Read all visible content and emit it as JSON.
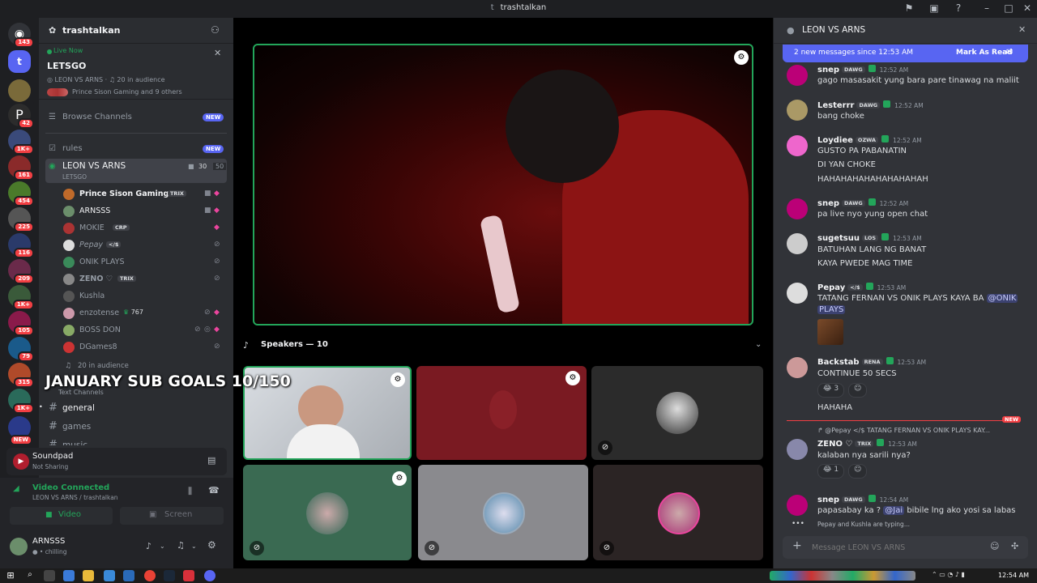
{
  "window": {
    "title": "trashtalkan"
  },
  "servers": [
    {
      "badge": "143"
    },
    {
      "badge": ""
    },
    {
      "badge": "42"
    },
    {
      "badge": "1K+"
    },
    {
      "badge": "161"
    },
    {
      "badge": "454"
    },
    {
      "badge": "225"
    },
    {
      "badge": "116"
    },
    {
      "badge": "209"
    },
    {
      "badge": "1K+"
    },
    {
      "badge": "105"
    },
    {
      "badge": "79"
    },
    {
      "badge": "315"
    },
    {
      "badge": "1K+"
    },
    {
      "badge": "NEW"
    }
  ],
  "sidebar": {
    "server_name": "trashtalkan",
    "live": {
      "status": "Live Now",
      "title": "LETSGO",
      "channel": "LEON VS ARNS",
      "audience": "20 in audience",
      "watchers": "Prince Sison Gaming and 9 others"
    },
    "browse": "Browse Channels",
    "new_label": "NEW",
    "rules": "rules",
    "voice_channel": {
      "name": "LEON VS ARNS",
      "status": "LETSGO",
      "count_a": "30",
      "count_b": "50"
    },
    "members": [
      {
        "name": "Prince Sison Gaming",
        "tag": "TRIX",
        "color": "#c06a2a"
      },
      {
        "name": "ARNSSS",
        "tag": "",
        "color": "#6b8e6b"
      },
      {
        "name": "MOKIE",
        "tag": "CRP",
        "color": "#a33"
      },
      {
        "name": "Pepay",
        "tag": "</$",
        "color": "#ddd"
      },
      {
        "name": "ONIK PLAYS",
        "tag": "",
        "color": "#3a8a5a"
      },
      {
        "name": "ZENO ♡",
        "tag": "TRIX",
        "color": "#888"
      },
      {
        "name": "Kushla",
        "tag": "",
        "color": "#555"
      },
      {
        "name": "enzotense",
        "tag": "767",
        "color": "#c9a"
      },
      {
        "name": "BOSS DON",
        "tag": "",
        "color": "#8a6"
      },
      {
        "name": "DGames8",
        "tag": "",
        "color": "#c33"
      }
    ],
    "audience": "20 in audience",
    "overlay": "JANUARY SUB GOALS 10/150",
    "text_channels_header": "Text Channels",
    "text_channels": [
      "general",
      "games",
      "music"
    ]
  },
  "panel": {
    "app": "Soundpad",
    "app_status": "Not Sharing",
    "connection": "Video Connected",
    "connection_sub": "LEON VS ARNS / trashtalkan",
    "video_btn": "Video",
    "screen_btn": "Screen",
    "user": "ARNSSS",
    "user_status": "chilling"
  },
  "stage": {
    "speakers_label": "Speakers — 10"
  },
  "chat": {
    "channel": "LEON VS ARNS",
    "new_banner": "2 new messages since 12:53 AM",
    "mark_read": "Mark As Read",
    "messages": [
      {
        "user": "snep",
        "tag": "DAWG",
        "time": "12:52 AM",
        "lines": [
          "gago masasakit yung bara pare tinawag na maliit"
        ],
        "color": "#b07"
      },
      {
        "user": "Lesterrr",
        "tag": "DAWG",
        "time": "12:52 AM",
        "lines": [
          "bang choke"
        ],
        "color": "#a96"
      },
      {
        "user": "Loydiee",
        "tag": "OZWA",
        "time": "12:52 AM",
        "lines": [
          "GUSTO PA PABANATIN",
          "DI YAN CHOKE",
          "HAHAHAHAHAHAHAHAHAH"
        ],
        "color": "#e6c"
      },
      {
        "user": "snep",
        "tag": "DAWG",
        "time": "12:52 AM",
        "lines": [
          "pa live nyo yung open chat"
        ],
        "color": "#b07"
      },
      {
        "user": "sugetsuu",
        "tag": "LOS",
        "time": "12:53 AM",
        "lines": [
          "BATUHAN LANG NG BANAT",
          "KAYA PWEDE MAG TIME"
        ],
        "color": "#ccc"
      },
      {
        "user": "Pepay",
        "tag": "</$",
        "time": "12:53 AM",
        "lines": [
          "TATANG FERNAN VS ONIK PLAYS KAYA BA",
          "PLAYS"
        ],
        "mention": "@ONIK",
        "color": "#ddd"
      },
      {
        "user": "Backstab",
        "tag": "RENA",
        "time": "12:53 AM",
        "lines": [
          "CONTINUE 50 SECS",
          "HAHAHA"
        ],
        "reaction": "3",
        "color": "#c99"
      },
      {
        "user": "ZENO ♡",
        "tag": "TRIX",
        "time": "12:53 AM",
        "lines": [
          "kalaban nya sarili nya?"
        ],
        "reaction": "1",
        "reply": "@Pepay  </$  TATANG FERNAN VS ONIK PLAYS KAY...",
        "color": "#88a"
      },
      {
        "user": "snep",
        "tag": "DAWG",
        "time": "12:54 AM",
        "lines": [
          "papasabay ka ?",
          "bibile lng ako yosi sa labas"
        ],
        "mention": "@Jai",
        "color": "#b07"
      }
    ],
    "new_label": "NEW",
    "typing": "Pepay and Kushla are typing...",
    "input_placeholder": "Message LEON VS ARNS"
  },
  "taskbar": {
    "time": "12:54 AM"
  },
  "colors": {
    "accent": "#5865f2",
    "online": "#23a55a",
    "danger": "#f23f43"
  }
}
